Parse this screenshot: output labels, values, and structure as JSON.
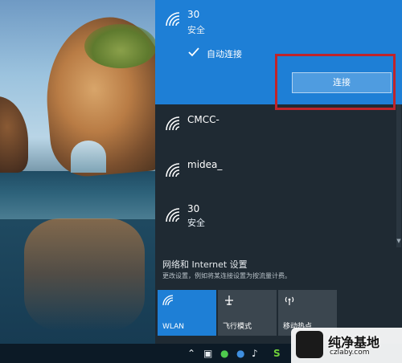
{
  "networks": [
    {
      "name": "30",
      "status": "安全",
      "selected": true
    },
    {
      "name": "CMCC-",
      "status": "",
      "selected": false
    },
    {
      "name": "midea_",
      "status": "",
      "selected": false
    },
    {
      "name": "30",
      "status": "安全",
      "selected": false
    }
  ],
  "selected_network": {
    "auto_connect_label": "自动连接",
    "auto_connect_checked": true,
    "connect_button_label": "连接"
  },
  "settings": {
    "title": "网络和 Internet 设置",
    "description": "更改设置，例如将某连接设置为按流量计费。"
  },
  "quick_actions": [
    {
      "label": "WLAN",
      "icon": "wifi-icon",
      "active": true
    },
    {
      "label": "飞行模式",
      "icon": "airplane-icon",
      "active": false
    },
    {
      "label": "移动热点",
      "icon": "hotspot-icon",
      "active": false
    }
  ],
  "taskbar_icons": [
    "chevron-up-icon",
    "network-icon",
    "wechat-icon",
    "browser-icon",
    "volume-icon",
    "s-app-icon"
  ],
  "watermark": {
    "title": "纯净基地",
    "url": "czlaby.com"
  },
  "colors": {
    "accent": "#1e7fd6",
    "flyout_bg": "#1f2a33",
    "highlight_red": "#c0242a",
    "tile_inactive": "#3b464f"
  }
}
